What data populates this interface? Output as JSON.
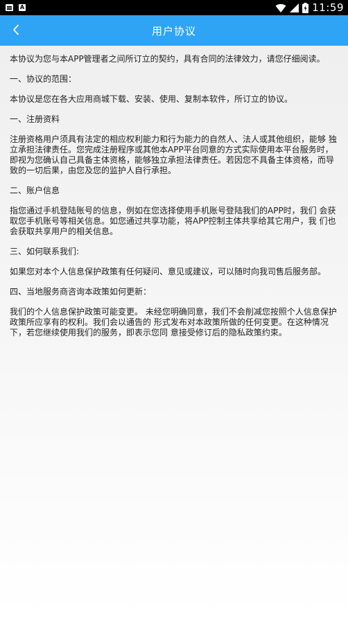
{
  "status_bar": {
    "time": "11:59",
    "left_icons": [
      "message-icon",
      "a-notification-icon"
    ],
    "a_label": "A",
    "right_icons": [
      "wifi-icon",
      "signal-icon",
      "battery-icon"
    ]
  },
  "app_bar": {
    "title": "用户协议",
    "back_icon": "chevron-left-icon",
    "color": "#2fa4f4"
  },
  "content": {
    "intro": "本协议为您与本APP管理者之间所订立的契约，具有合同的法律效力，请您仔细阅读。",
    "sections": [
      {
        "heading": "一、协议的范围：",
        "body": "本协议是您在各大应用商城下载、安装、使用、复制本软件，所订立的协议。"
      },
      {
        "heading": "一、注册资料",
        "body": "注册资格用户须具有法定的相应权利能力和行为能力的自然人、法人或其他组织，能够 独立承担法律责任。您完成注册程序或其他本APP平台同意的方式实际使用本平台服务时，即视为您确认自己具备主体资格，能够独立承担法律责任。若因您不具备主体资格，而导致的一切后果，由您及您的监护人自行承担。"
      },
      {
        "heading": "二、账户信息",
        "body": "指您通过手机登陆账号的信息，例如在您选择使用手机账号登陆我们的APP时，我们 会获取您手机账号等相关信息。如您通过共享功能，将APP控制主体共享给其它用户，我 们也会获取共享用户的相关信息。"
      },
      {
        "heading": "三、如何联系我们:",
        "body": "如果您对本个人信息保护政策有任何疑问、意见或建议，可以随时向我司售后服务部。"
      },
      {
        "heading": "四、当地服务商咨询本政策如何更新：",
        "body": "我们的个人信息保护政策可能变更。 未经您明确同意，我们不会削减您按照个人信息保护政策所应享有的权利。我们会以通告的 形式发布对本政策所做的任何变更。在这种情况下，若您继续使用我们的服务，即表示您同 意接受修订后的隐私政策约束。"
      }
    ]
  }
}
